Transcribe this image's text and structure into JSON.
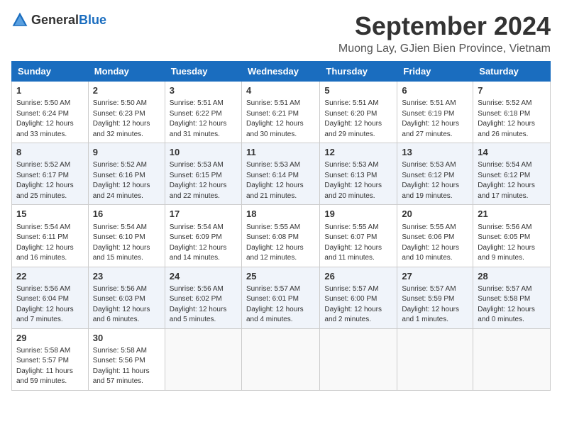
{
  "header": {
    "logo_general": "General",
    "logo_blue": "Blue",
    "month_title": "September 2024",
    "location": "Muong Lay, GJien Bien Province, Vietnam"
  },
  "calendar": {
    "columns": [
      "Sunday",
      "Monday",
      "Tuesday",
      "Wednesday",
      "Thursday",
      "Friday",
      "Saturday"
    ],
    "weeks": [
      [
        {
          "day": "1",
          "sunrise": "5:50 AM",
          "sunset": "6:24 PM",
          "daylight": "12 hours and 33 minutes."
        },
        {
          "day": "2",
          "sunrise": "5:50 AM",
          "sunset": "6:23 PM",
          "daylight": "12 hours and 32 minutes."
        },
        {
          "day": "3",
          "sunrise": "5:51 AM",
          "sunset": "6:22 PM",
          "daylight": "12 hours and 31 minutes."
        },
        {
          "day": "4",
          "sunrise": "5:51 AM",
          "sunset": "6:21 PM",
          "daylight": "12 hours and 30 minutes."
        },
        {
          "day": "5",
          "sunrise": "5:51 AM",
          "sunset": "6:20 PM",
          "daylight": "12 hours and 29 minutes."
        },
        {
          "day": "6",
          "sunrise": "5:51 AM",
          "sunset": "6:19 PM",
          "daylight": "12 hours and 27 minutes."
        },
        {
          "day": "7",
          "sunrise": "5:52 AM",
          "sunset": "6:18 PM",
          "daylight": "12 hours and 26 minutes."
        }
      ],
      [
        {
          "day": "8",
          "sunrise": "5:52 AM",
          "sunset": "6:17 PM",
          "daylight": "12 hours and 25 minutes."
        },
        {
          "day": "9",
          "sunrise": "5:52 AM",
          "sunset": "6:16 PM",
          "daylight": "12 hours and 24 minutes."
        },
        {
          "day": "10",
          "sunrise": "5:53 AM",
          "sunset": "6:15 PM",
          "daylight": "12 hours and 22 minutes."
        },
        {
          "day": "11",
          "sunrise": "5:53 AM",
          "sunset": "6:14 PM",
          "daylight": "12 hours and 21 minutes."
        },
        {
          "day": "12",
          "sunrise": "5:53 AM",
          "sunset": "6:13 PM",
          "daylight": "12 hours and 20 minutes."
        },
        {
          "day": "13",
          "sunrise": "5:53 AM",
          "sunset": "6:12 PM",
          "daylight": "12 hours and 19 minutes."
        },
        {
          "day": "14",
          "sunrise": "5:54 AM",
          "sunset": "6:12 PM",
          "daylight": "12 hours and 17 minutes."
        }
      ],
      [
        {
          "day": "15",
          "sunrise": "5:54 AM",
          "sunset": "6:11 PM",
          "daylight": "12 hours and 16 minutes."
        },
        {
          "day": "16",
          "sunrise": "5:54 AM",
          "sunset": "6:10 PM",
          "daylight": "12 hours and 15 minutes."
        },
        {
          "day": "17",
          "sunrise": "5:54 AM",
          "sunset": "6:09 PM",
          "daylight": "12 hours and 14 minutes."
        },
        {
          "day": "18",
          "sunrise": "5:55 AM",
          "sunset": "6:08 PM",
          "daylight": "12 hours and 12 minutes."
        },
        {
          "day": "19",
          "sunrise": "5:55 AM",
          "sunset": "6:07 PM",
          "daylight": "12 hours and 11 minutes."
        },
        {
          "day": "20",
          "sunrise": "5:55 AM",
          "sunset": "6:06 PM",
          "daylight": "12 hours and 10 minutes."
        },
        {
          "day": "21",
          "sunrise": "5:56 AM",
          "sunset": "6:05 PM",
          "daylight": "12 hours and 9 minutes."
        }
      ],
      [
        {
          "day": "22",
          "sunrise": "5:56 AM",
          "sunset": "6:04 PM",
          "daylight": "12 hours and 7 minutes."
        },
        {
          "day": "23",
          "sunrise": "5:56 AM",
          "sunset": "6:03 PM",
          "daylight": "12 hours and 6 minutes."
        },
        {
          "day": "24",
          "sunrise": "5:56 AM",
          "sunset": "6:02 PM",
          "daylight": "12 hours and 5 minutes."
        },
        {
          "day": "25",
          "sunrise": "5:57 AM",
          "sunset": "6:01 PM",
          "daylight": "12 hours and 4 minutes."
        },
        {
          "day": "26",
          "sunrise": "5:57 AM",
          "sunset": "6:00 PM",
          "daylight": "12 hours and 2 minutes."
        },
        {
          "day": "27",
          "sunrise": "5:57 AM",
          "sunset": "5:59 PM",
          "daylight": "12 hours and 1 minute."
        },
        {
          "day": "28",
          "sunrise": "5:57 AM",
          "sunset": "5:58 PM",
          "daylight": "12 hours and 0 minutes."
        }
      ],
      [
        {
          "day": "29",
          "sunrise": "5:58 AM",
          "sunset": "5:57 PM",
          "daylight": "11 hours and 59 minutes."
        },
        {
          "day": "30",
          "sunrise": "5:58 AM",
          "sunset": "5:56 PM",
          "daylight": "11 hours and 57 minutes."
        },
        null,
        null,
        null,
        null,
        null
      ]
    ]
  }
}
